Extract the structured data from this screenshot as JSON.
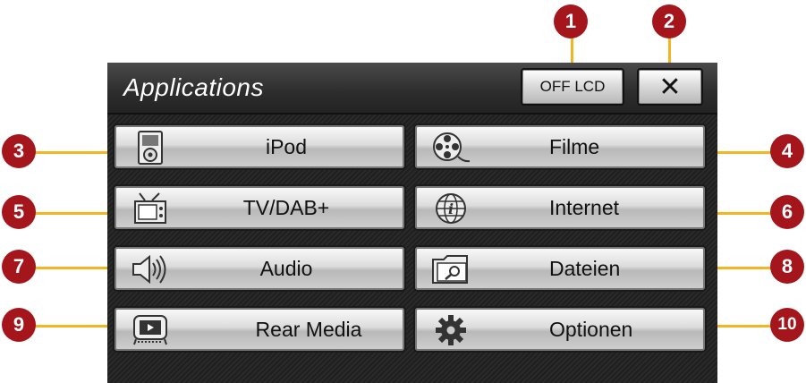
{
  "header": {
    "title": "Applications",
    "off_lcd_label": "OFF LCD",
    "close_label": "✕"
  },
  "apps": [
    {
      "label": "iPod",
      "icon": "ipod-icon"
    },
    {
      "label": "Filme",
      "icon": "film-reel-icon"
    },
    {
      "label": "TV/DAB+",
      "icon": "tv-icon"
    },
    {
      "label": "Internet",
      "icon": "globe-icon"
    },
    {
      "label": "Audio",
      "icon": "speaker-icon"
    },
    {
      "label": "Dateien",
      "icon": "folder-icon"
    },
    {
      "label": "Rear Media",
      "icon": "rear-monitor-icon"
    },
    {
      "label": "Optionen",
      "icon": "gear-icon"
    }
  ],
  "callouts": [
    "1",
    "2",
    "3",
    "4",
    "5",
    "6",
    "7",
    "8",
    "9",
    "10"
  ],
  "colors": {
    "badge": "#a5151c",
    "leader": "#f2b623"
  }
}
